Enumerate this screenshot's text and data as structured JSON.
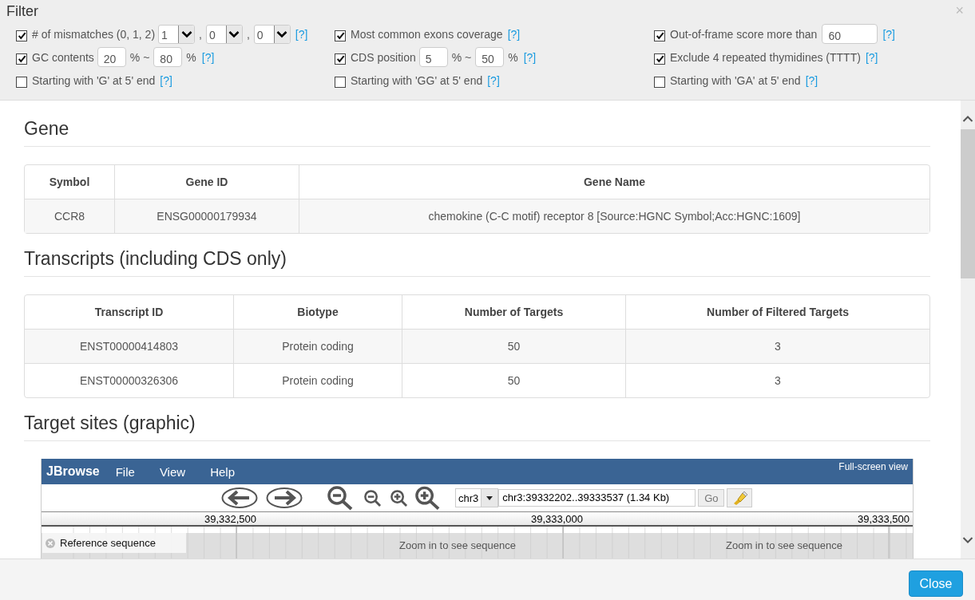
{
  "filter": {
    "title": "Filter",
    "close": "×",
    "items": [
      {
        "kind": "selects",
        "label": "# of mismatches (0, 1, 2)",
        "checked": true,
        "selects": [
          "1",
          "0",
          "0"
        ],
        "separators": [
          ",",
          ","
        ],
        "help": "[?]"
      },
      {
        "kind": "plain",
        "label": "Most common exons coverage",
        "checked": true,
        "help": "[?]"
      },
      {
        "kind": "number",
        "label": "Out-of-frame score more than",
        "checked": true,
        "value": "60",
        "help": "[?]"
      },
      {
        "kind": "range",
        "label": "GC contents",
        "checked": true,
        "from": "20",
        "separator": "% ~",
        "to": "80",
        "unit": "%",
        "help": "[?]"
      },
      {
        "kind": "range",
        "label": "CDS position",
        "checked": true,
        "from": "5",
        "separator": "% ~",
        "to": "50",
        "unit": "%",
        "help": "[?]"
      },
      {
        "kind": "plain",
        "label": "Exclude 4 repeated thymidines (TTTT)",
        "checked": true,
        "help": "[?]"
      },
      {
        "kind": "plain",
        "label": "Starting with 'G' at 5' end",
        "checked": false,
        "help": "[?]"
      },
      {
        "kind": "plain",
        "label": "Starting with 'GG' at 5' end",
        "checked": false,
        "help": "[?]"
      },
      {
        "kind": "plain",
        "label": "Starting with 'GA' at 5' end",
        "checked": false,
        "help": "[?]"
      }
    ]
  },
  "gene": {
    "title": "Gene",
    "columns": [
      "Symbol",
      "Gene ID",
      "Gene Name"
    ],
    "rows": [
      [
        "CCR8",
        "ENSG00000179934",
        "chemokine (C-C motif) receptor 8 [Source:HGNC Symbol;Acc:HGNC:1609]"
      ]
    ]
  },
  "transcripts": {
    "title": "Transcripts (including CDS only)",
    "columns": [
      "Transcript ID",
      "Biotype",
      "Number of Targets",
      "Number of Filtered Targets"
    ],
    "rows": [
      [
        "ENST00000414803",
        "Protein coding",
        "50",
        "3"
      ],
      [
        "ENST00000326306",
        "Protein coding",
        "50",
        "3"
      ]
    ]
  },
  "target_sites": {
    "title": "Target sites (graphic)",
    "jbrowse": {
      "brand": "JBrowse",
      "menu": [
        "File",
        "View",
        "Help"
      ],
      "fullscreen": "Full-screen view",
      "chrom": "chr3",
      "location": "chr3:39332202..39333537 (1.34 Kb)",
      "go": "Go",
      "ruler": [
        "39,332,500",
        "39,333,000",
        "39,333,500"
      ],
      "track_label": "Reference sequence",
      "messages": [
        "Zoom in to see sequence",
        "Zoom in to see sequence"
      ]
    }
  },
  "footer": {
    "close_button": "Close"
  }
}
